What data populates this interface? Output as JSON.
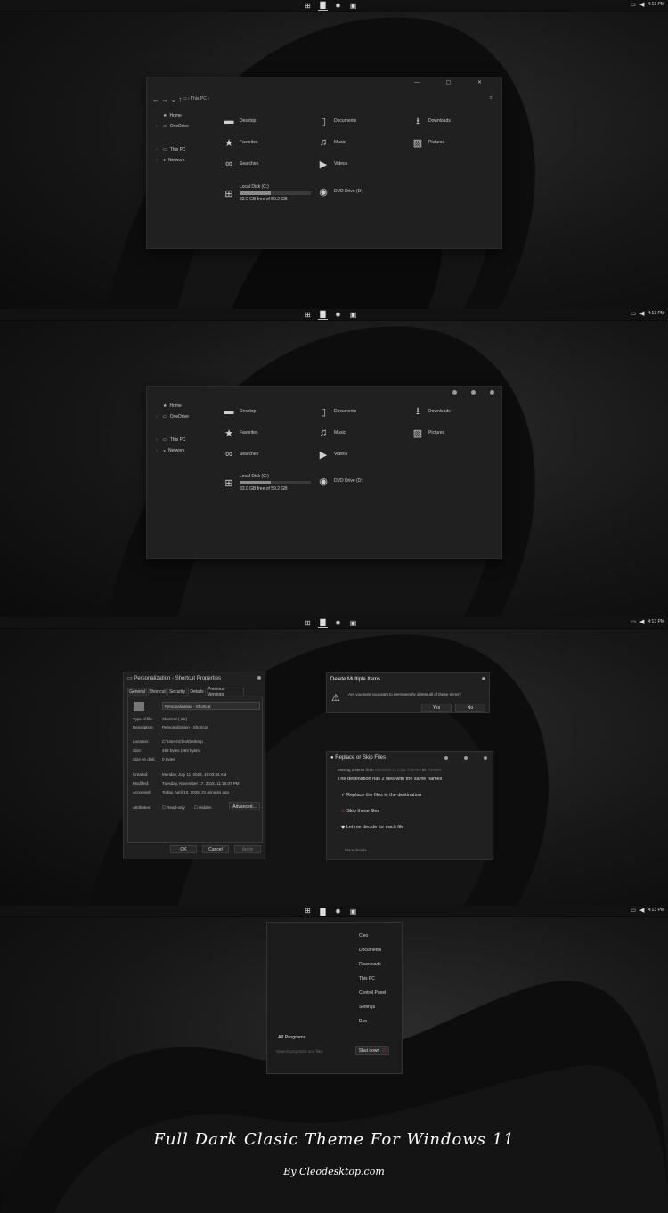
{
  "taskbar": {
    "time": "4:13 PM",
    "icons": [
      "windows-logo-icon",
      "folder-icon",
      "gear-icon",
      "store-icon"
    ]
  },
  "explorer": {
    "breadcrumb": "This PC",
    "nav": [
      {
        "label": "Home",
        "icon": "★"
      },
      {
        "label": "OneDrive",
        "icon": "▭"
      },
      {
        "label": "This PC",
        "icon": "▭"
      },
      {
        "label": "Network",
        "icon": "◒"
      }
    ],
    "folders": [
      {
        "label": "Desktop"
      },
      {
        "label": "Documents"
      },
      {
        "label": "Downloads"
      },
      {
        "label": "Favorites"
      },
      {
        "label": "Music"
      },
      {
        "label": "Pictures"
      },
      {
        "label": "Searches"
      },
      {
        "label": "Videos"
      }
    ],
    "disk": {
      "name": "Local Disk (C:)",
      "free": "33.0 GB free of 59.2 GB",
      "used_fraction": 0.44
    },
    "dvd": "DVD Drive (D:)"
  },
  "props": {
    "title": "Personalization - Shortcut Properties",
    "tabs": [
      "General",
      "Shortcut",
      "Security",
      "Details",
      "Previous Versions"
    ],
    "name": "Personalization - Shortcut",
    "rows": [
      [
        "Type of file:",
        "Shortcut (.lnk)"
      ],
      [
        "Description:",
        "Personalization - Shortcut"
      ],
      [
        "Location:",
        "C:\\Users\\Cleo\\Desktop"
      ],
      [
        "Size:",
        "493 bytes (493 bytes)"
      ],
      [
        "Size on disk:",
        "0 bytes"
      ],
      [
        "Created:",
        "Monday, July 11, 2022, 10:03:34 AM"
      ],
      [
        "Modified:",
        "Tuesday, November 17, 2015, 11:15:07 PM"
      ],
      [
        "Accessed:",
        "Today, April 13, 2025, 21 minutes ago"
      ]
    ],
    "attributes": "Attributes:",
    "readonly": "Read-only",
    "hidden": "Hidden",
    "advanced": "Advanced...",
    "ok": "OK",
    "cancel": "Cancel",
    "apply": "Apply"
  },
  "delete_dialog": {
    "title": "Delete Multiple Items",
    "message": "Are you sure you want to permanently delete all of these items?",
    "yes": "Yes",
    "no": "No"
  },
  "replace_dialog": {
    "title": "Replace or Skip Files",
    "moving_a": "Moving 2 items from",
    "moving_src": "Windows 11 CSS Themes",
    "moving_to": "to",
    "moving_dst": "Themes",
    "headline": "The destination has 2 files with the same names",
    "options": [
      "Replace the files in the destination",
      "Skip these files",
      "Let me decide for each file"
    ],
    "more": "More details"
  },
  "start_menu": {
    "items": [
      "Cleo",
      "Documents",
      "Downloads",
      "This PC",
      "Control Panel",
      "Settings",
      "Run..."
    ],
    "all_programs": "All Programs",
    "search_placeholder": "Search programs and files",
    "shutdown": "Shut down"
  },
  "footer": {
    "title": "Full Dark Clasic Theme For Windows 11",
    "byline": "By Cleodesktop.com"
  }
}
